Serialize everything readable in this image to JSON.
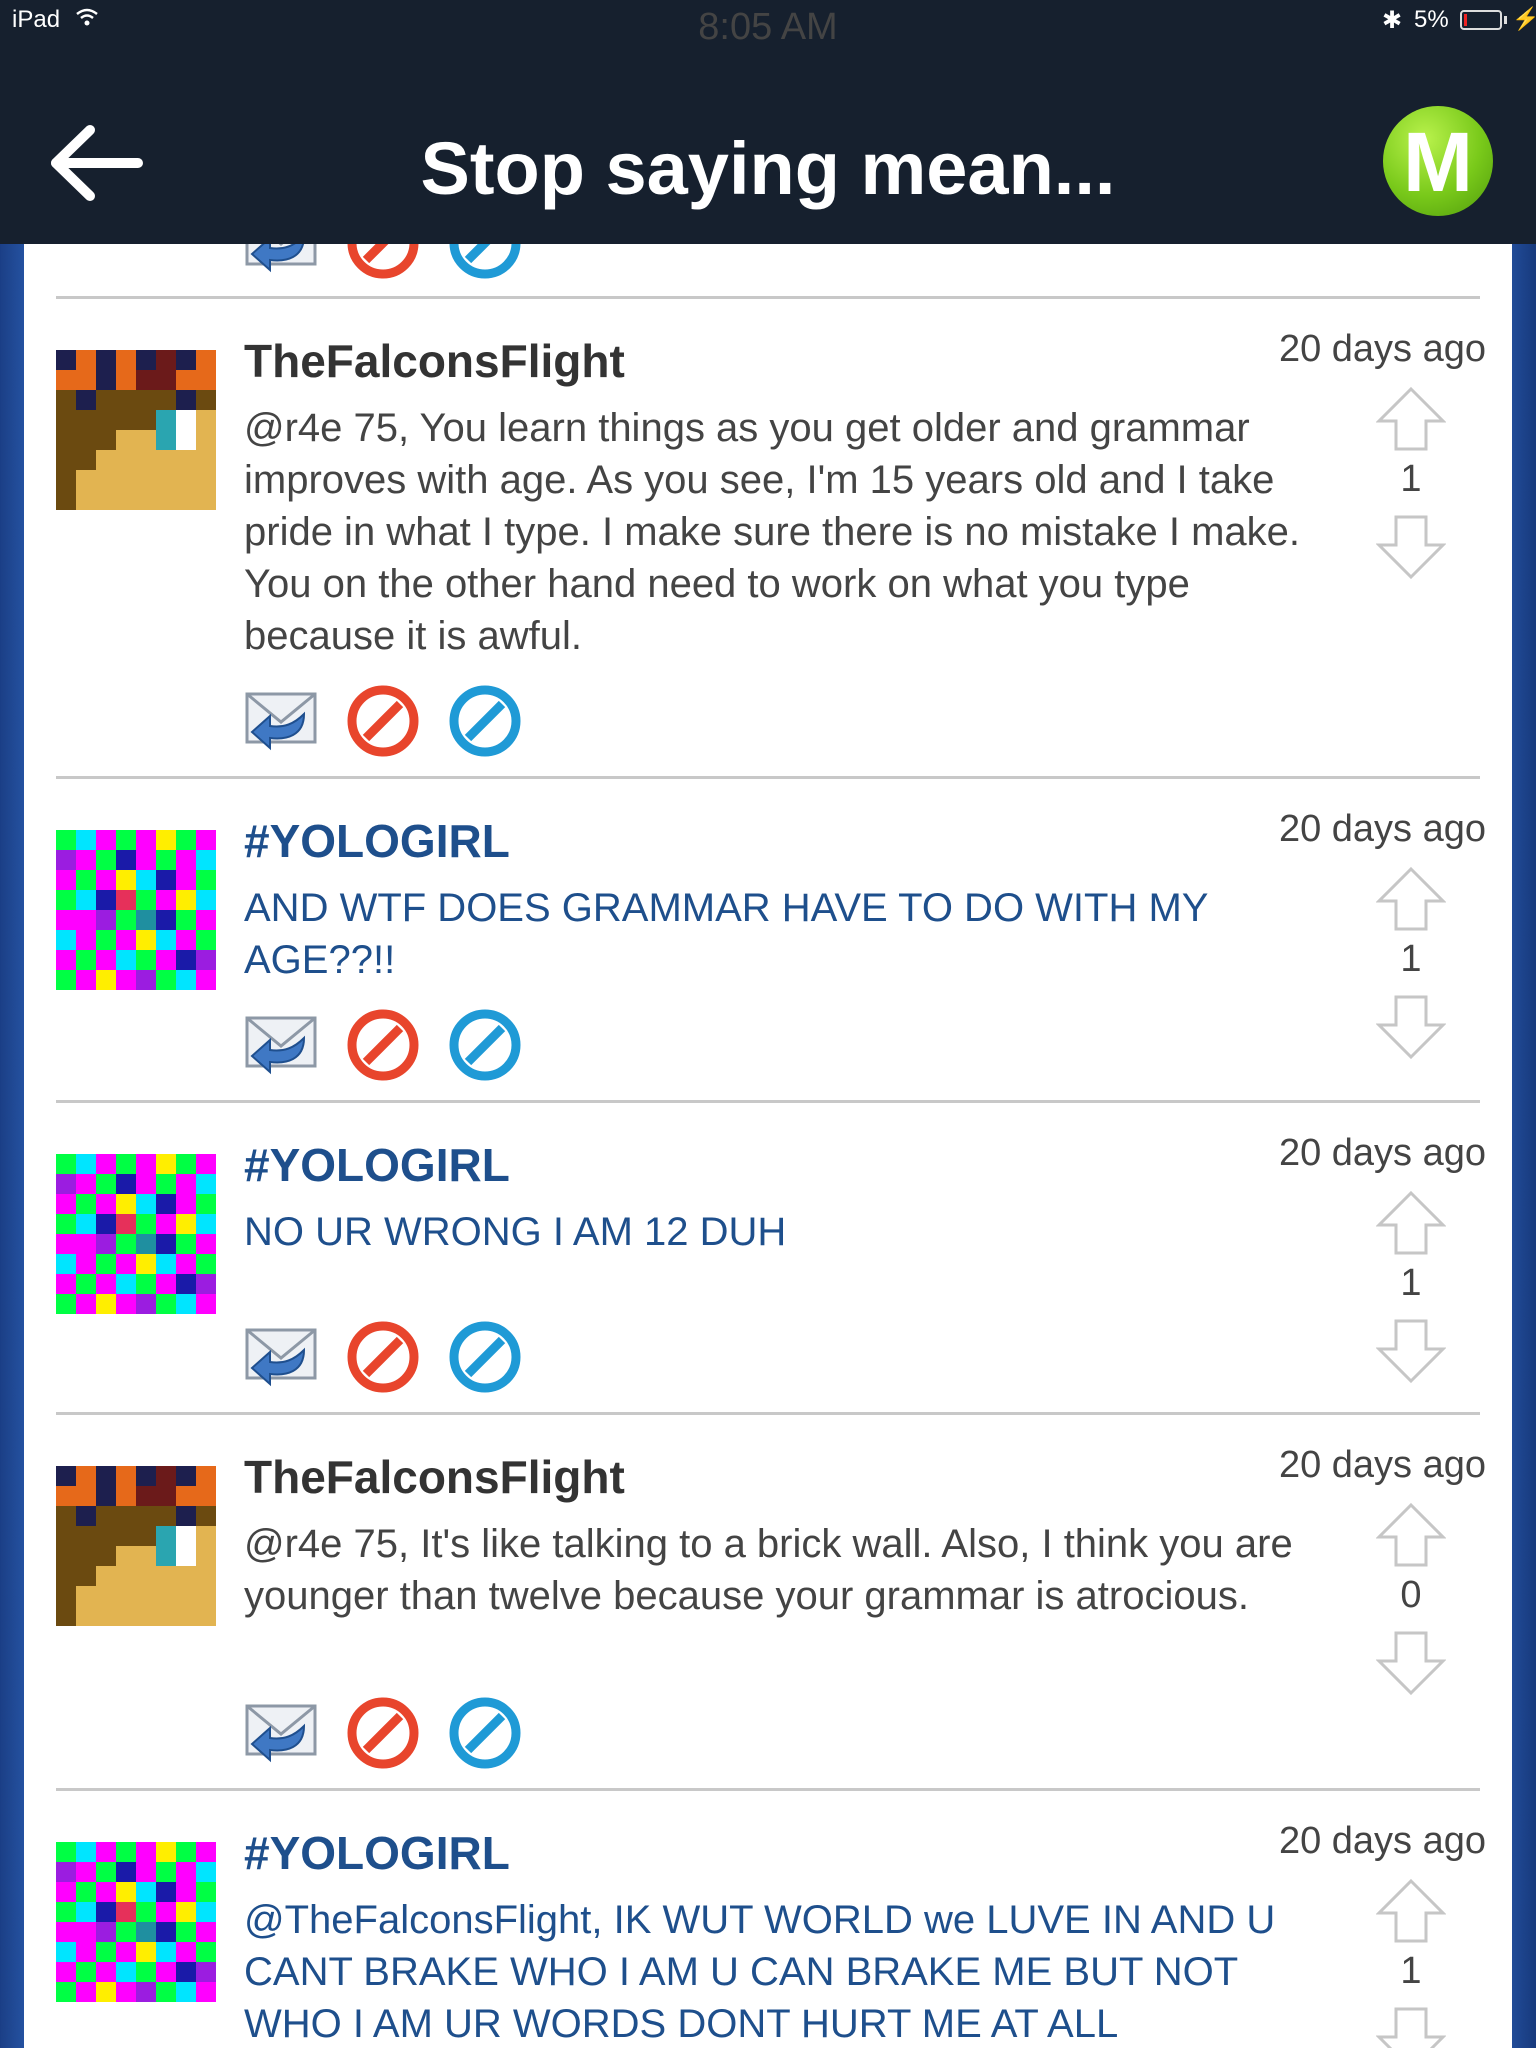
{
  "status_bar": {
    "device": "iPad",
    "time": "8:05 AM",
    "battery": "5%"
  },
  "nav": {
    "title": "Stop saying mean...",
    "logo_letter": "M"
  },
  "posts": [
    {
      "user": "TheFalconsFlight",
      "time": "20 days ago",
      "text": "@r4e 75, You learn things as you get older and grammar improves with age. As you see, I'm 15 years old and I take pride in what I type. I make sure there is no mistake I make. You on the other hand need to work on what you type because it is awful.",
      "score": "1"
    },
    {
      "user": "#YOLOGIRL",
      "time": "20 days ago",
      "text": "AND WTF DOES GRAMMAR HAVE TO DO WITH MY AGE??!!",
      "score": "1"
    },
    {
      "user": "#YOLOGIRL",
      "time": "20 days ago",
      "text": "NO UR WRONG I AM 12 DUH",
      "score": "1"
    },
    {
      "user": "TheFalconsFlight",
      "time": "20 days ago",
      "text": "@r4e 75, It's like talking to a brick wall. Also, I think you are younger than twelve because your grammar is atrocious.",
      "score": "0"
    },
    {
      "user": "#YOLOGIRL",
      "time": "20 days ago",
      "text": "@TheFalconsFlight, IK WUT WORLD we LUVE IN AND U CANT BRAKE WHO I AM U CAN BRAKE ME BUT NOT WHO I AM UR WORDS DONT HURT ME AT ALL",
      "score": "1"
    }
  ],
  "colors": {
    "nav_bg": "#16202e",
    "username_blue": "#1e4f8c",
    "logo_green": "#79c91a"
  },
  "icons": {
    "reply": "reply-envelope-icon",
    "block": "block-red-icon",
    "ignore": "ignore-blue-icon",
    "upvote": "upvote-arrow-icon",
    "downvote": "downvote-arrow-icon"
  }
}
